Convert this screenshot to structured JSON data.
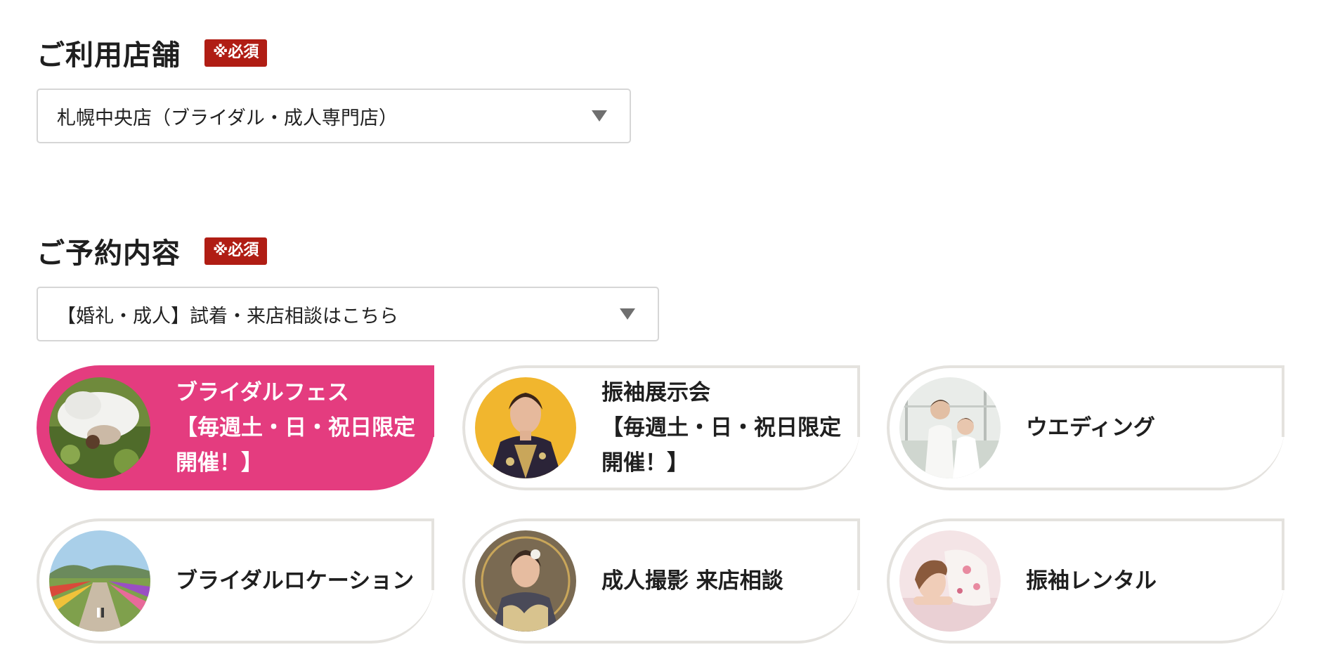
{
  "store_section": {
    "title": "ご利用店舗",
    "required": "※必須",
    "select_value": "札幌中央店（ブライダル・成人専門店）"
  },
  "reservation_section": {
    "title": "ご予約内容",
    "required": "※必須",
    "select_value": "【婚礼・成人】試着・来店相談はこちら"
  },
  "options": [
    {
      "lines": [
        "ブライダルフェス",
        "【毎週土・日・祝日限定",
        "開催！】"
      ],
      "selected": true,
      "image": "bride-on-grass-photo"
    },
    {
      "lines": [
        "振袖展示会",
        "【毎週土・日・祝日限定",
        "開催！】"
      ],
      "selected": false,
      "image": "furisode-woman-yellow-photo"
    },
    {
      "lines": [
        "ウエディング"
      ],
      "selected": false,
      "image": "wedding-couple-photo"
    },
    {
      "lines": [
        "ブライダルロケーション"
      ],
      "selected": false,
      "image": "flower-field-location-photo"
    },
    {
      "lines": [
        "成人撮影 来店相談"
      ],
      "selected": false,
      "image": "seijin-kimono-portrait-photo"
    },
    {
      "lines": [
        "振袖レンタル"
      ],
      "selected": false,
      "image": "furisode-rental-photo"
    }
  ],
  "colors": {
    "accent": "#e43c7f",
    "required_badge": "#b01d14",
    "card_border": "#e4e2de",
    "select_border": "#d6d6d6"
  }
}
